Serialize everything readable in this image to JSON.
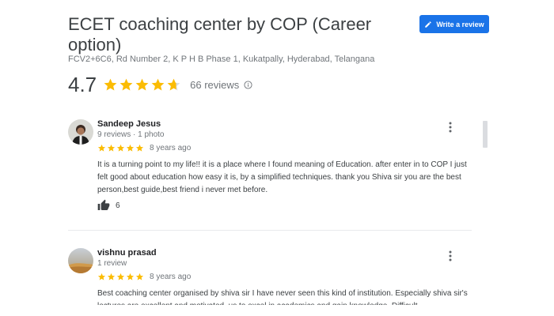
{
  "place": {
    "title": "ECET coaching center by COP (Career option)",
    "address": "FCV2+6C6, Rd Number 2, K P H B Phase 1, Kukatpally, Hyderabad, Telangana",
    "rating": "4.7",
    "rating_stars": 4.7,
    "review_count": "66 reviews"
  },
  "actions": {
    "write_review_label": "Write a review"
  },
  "colors": {
    "accent": "#1a73e8",
    "star": "#fbbc04",
    "star_empty": "#dadce0"
  },
  "reviews": [
    {
      "name": "Sandeep Jesus",
      "meta": "9 reviews · 1 photo",
      "stars": 5,
      "date": "8 years ago",
      "text": "It is a turning point to my life!! it is a place where I found meaning of Education. after enter in to COP I just felt good about education how easy it is, by a simplified techniques. thank you Shiva sir you are the best person,best guide,best friend i never met before.",
      "likes": "6"
    },
    {
      "name": "vishnu prasad",
      "meta": "1 review",
      "stars": 5,
      "date": "8 years ago",
      "text": "Best coaching center organised by shiva sir I have never seen this kind of institution. Especially shiva sir's lectures are excellent and motivated, us to excel in academics and gain knowledge. Difficult"
    }
  ]
}
